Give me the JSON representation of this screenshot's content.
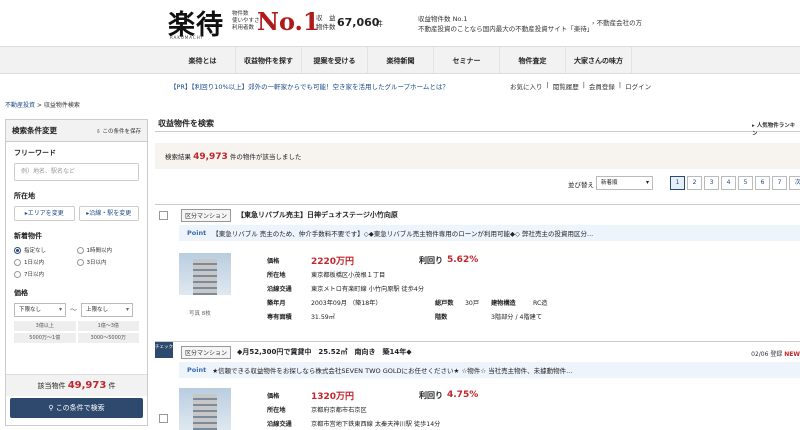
{
  "header": {
    "logo": "楽待",
    "logo_sub": "RAKUMACHI",
    "tagline": [
      "物件数",
      "使いやすさ",
      "利用者数"
    ],
    "no1": "No.1",
    "stat_label_1": "収　益",
    "stat_label_2": "物件数",
    "stat_count": "67,060",
    "stat_unit": "件",
    "desc_1": "収益物件数 No.1",
    "desc_2": "不動産投資のことなら国内最大の不動産投資サイト「楽待」",
    "company_link": "不動産会社の方"
  },
  "nav": [
    "楽待とは",
    "収益物件を探す",
    "提案を受ける",
    "楽待新聞",
    "セミナー",
    "物件査定",
    "大家さんの味方"
  ],
  "pr": "【PR】【利回り10%以上】郊外の一軒家からでも可能！空き家を活用したグループホームとは？",
  "sublinks": [
    "お気に入り",
    "閲覧履歴",
    "会員登録",
    "ログイン"
  ],
  "breadcrumb": {
    "home": "不動産投資",
    "sep": ">",
    "current": "収益物件検索"
  },
  "sidebar": {
    "title": "検索条件変更",
    "save": "この条件を保存",
    "freeword_title": "フリーワード",
    "freeword_placeholder": "例）地名、駅名など",
    "location_title": "所在地",
    "area_btn": "エリアを変更",
    "line_btn": "沿線・駅を変更",
    "new_title": "新着物件",
    "new_options": [
      "指定なし",
      "1時間以内",
      "1日以内",
      "3日以内",
      "7日以内"
    ],
    "price_title": "価格",
    "price_min": "下限なし",
    "price_max": "上限なし",
    "tilde": "〜",
    "price_chips": [
      "3億以上",
      "1億〜3億",
      "5000万〜1億",
      "3000〜5000万"
    ],
    "count_label": "該当物件",
    "count": "49,973",
    "count_unit": "件",
    "search_btn": "この条件で検索"
  },
  "main": {
    "title": "収益物件を検索",
    "ninki": "人気物件ランキン",
    "result_label": "検索結果",
    "result_count": "49,973",
    "result_suffix": "件の物件が該当しました",
    "sort_label": "並び替え",
    "sort_value": "新着順",
    "pages": [
      "1",
      "2",
      "3",
      "4",
      "5",
      "6",
      "7"
    ],
    "next": "次へ"
  },
  "listings": [
    {
      "type": "区分マンション",
      "title": "【東急リバブル売主】日神デュオステージ小竹向原",
      "point_label": "Point",
      "point": "【東急リバブル 売主のため、仲介手数料不要です】◇◆東急リバブル売主物件専用のローンが利用可能◆◇ 弊社売主の投資用区分...",
      "price_label": "価格",
      "price": "2220万円",
      "yield_label": "利回り",
      "yield": "5.62%",
      "address_label": "所在地",
      "address": "東京都板橋区小茂根１丁目",
      "station_label": "沿線交通",
      "station": "東京メトロ有楽町線 小竹向原駅 徒歩4分",
      "built_label": "築年月",
      "built": "2003年09月 （築18年）",
      "floor_label": "総戸数",
      "floor": "30戸",
      "struct_label": "建物構造",
      "struct": "RC造",
      "area_label": "専有面積",
      "area": "31.59㎡",
      "story_label": "階数",
      "story": "3階部分 / 4階建て",
      "photo_caption": "写真 8枚"
    },
    {
      "tag": "チェック",
      "type": "区分マンション",
      "title": "◆月52,300円で賃貸中　25.52㎡　南向き　築14年◆",
      "date": "02/06 登録",
      "new": "NEW",
      "point_label": "Point",
      "point": "★信頼できる収益物件をお探しなら株式会社SEVEN TWO GOLDにお任せください★ ☆物件☆ 当社売主物件、未據動物件...",
      "price_label": "価格",
      "price": "1320万円",
      "yield_label": "利回り",
      "yield": "4.75%",
      "address_label": "所在地",
      "address": "京都府京都市右京区",
      "station_label": "沿線交通",
      "station": "京都市営地下鉄東西線 太秦天神川駅 徒歩14分"
    }
  ]
}
